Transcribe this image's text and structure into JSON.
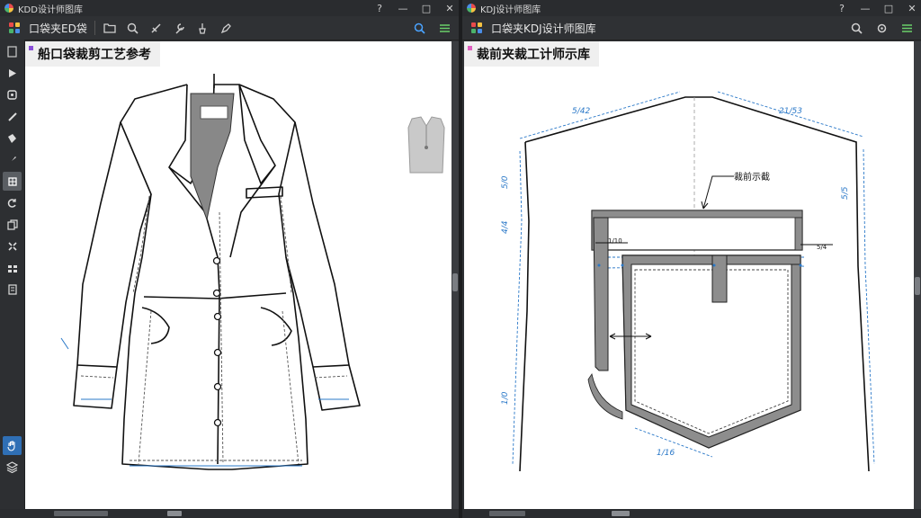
{
  "left_window": {
    "title": "KDD设计师图库",
    "app_label": "口袋夹ED袋",
    "sheet_title": "船口袋裁剪工艺参考",
    "window_controls": [
      "?",
      "—",
      "□",
      "✕"
    ]
  },
  "right_window": {
    "title": "KDJ设计师图库",
    "app_label": "口袋夹KDJ设计师图库",
    "sheet_title": "裁前夹裁工计师示库",
    "window_controls": [
      "?",
      "—",
      "□",
      "✕"
    ],
    "labels": {
      "top_left_dim": "5/42",
      "top_right_dim": "21/53",
      "callout": "裁前示截",
      "left_inner_dim": "1/10",
      "right_inner_dim": "5/4",
      "left_edge_dim_1": "5/0",
      "left_edge_dim_2": "1/0",
      "right_edge_dim": "5/5",
      "bottom_dim": "1/16",
      "left_low_dim": "4/4"
    }
  },
  "icons": {
    "left_toolbar": [
      "grid-icon",
      "folder-icon",
      "zoom-icon",
      "link-icon",
      "wrench-icon",
      "fill-icon",
      "pen-icon"
    ],
    "left_toolbar_right": [
      "search-icon",
      "ruler-icon"
    ],
    "right_toolbar": [
      "grid-icon",
      "folder-icon",
      "zoom-icon"
    ],
    "right_toolbar_right": [
      "search-icon",
      "settings-icon",
      "ruler-icon"
    ],
    "left_sidebar": [
      "layers-icon",
      "play-icon",
      "stop-icon",
      "link-icon",
      "bucket-icon",
      "brush-icon",
      "grid-icon",
      "rotate-icon",
      "copy-icon",
      "pattern-icon",
      "pattern2-icon",
      "dots-icon",
      "hand-icon",
      "stack-icon"
    ]
  },
  "colors": {
    "chrome": "#2f3134",
    "accent_blue": "#2f6fb5",
    "dimension_blue": "#2a78c8",
    "pocket_gray": "#8d8d8d"
  }
}
